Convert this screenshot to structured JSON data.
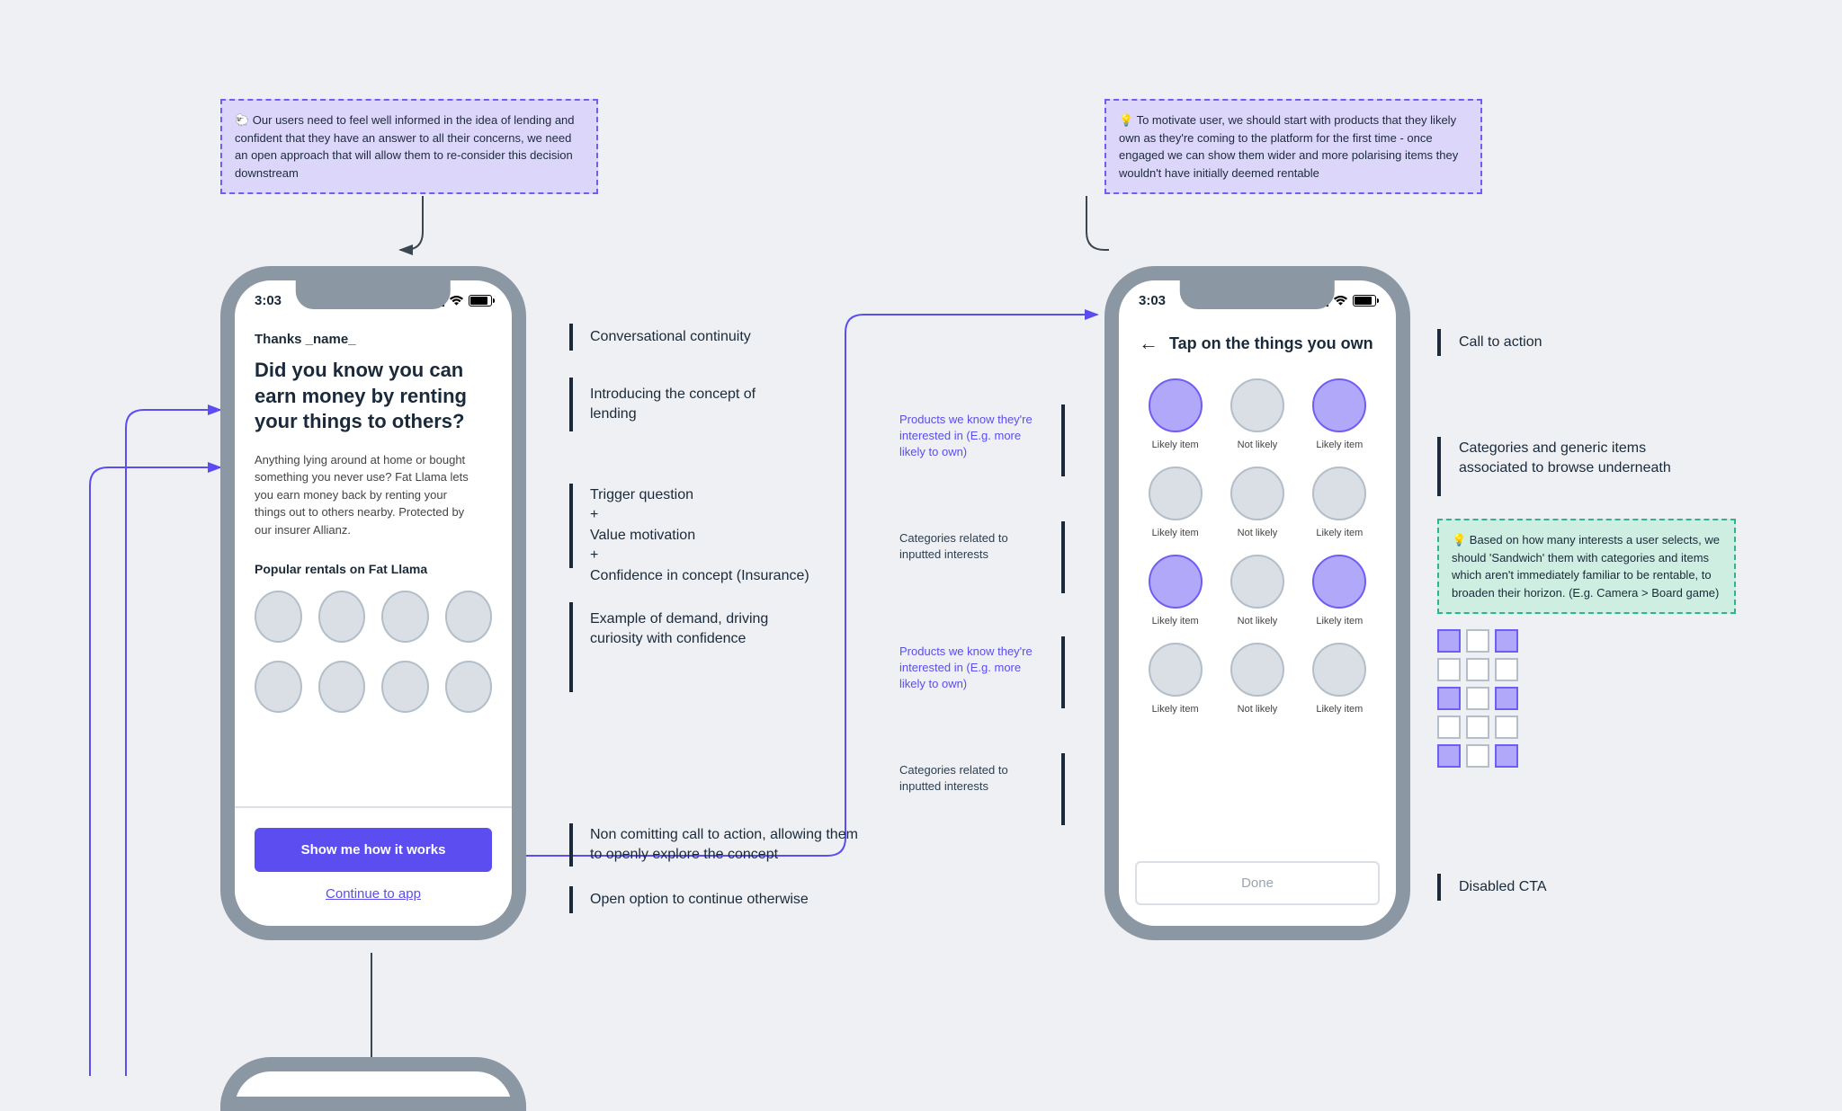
{
  "stickies": {
    "left_top": "🐑 Our users need to feel well informed in the idea of lending and confident that they have an answer to all their concerns, we need an open approach that will allow them to re-consider this decision downstream",
    "right_top": "💡 To motivate user, we should start with products that they likely own as they're coming to the platform for the first time - once engaged we can show them wider and more polarising items they wouldn't have initially deemed rentable",
    "teal": "💡 Based on how many interests a user selects, we should 'Sandwich' them with categories and items which aren't immediately familiar to be rentable, to broaden their horizon. (E.g. Camera > Board game)"
  },
  "phone1": {
    "time": "3:03",
    "greeting": "Thanks _name_",
    "headline": "Did you know you can earn money by renting your things to others?",
    "body": "Anything lying around at home or bought something you never use? Fat Llama lets you earn money back by renting your things out to others nearby. Protected by our insurer Allianz.",
    "popular_label": "Popular rentals on Fat Llama",
    "primary_cta": "Show me how it works",
    "secondary_link": "Continue to app"
  },
  "phone2": {
    "time": "3:03",
    "title": "Tap on the things you own",
    "done_label": "Done",
    "items": [
      {
        "label": "Likely item",
        "selected": true
      },
      {
        "label": "Not likely",
        "selected": false
      },
      {
        "label": "Likely item",
        "selected": true
      },
      {
        "label": "Likely item",
        "selected": false
      },
      {
        "label": "Not likely",
        "selected": false
      },
      {
        "label": "Likely item",
        "selected": false
      },
      {
        "label": "Likely item",
        "selected": true
      },
      {
        "label": "Not likely",
        "selected": false
      },
      {
        "label": "Likely item",
        "selected": true
      },
      {
        "label": "Likely item",
        "selected": false
      },
      {
        "label": "Not likely",
        "selected": false
      },
      {
        "label": "Likely item",
        "selected": false
      }
    ]
  },
  "annotations": {
    "a1": "Conversational continuity",
    "a2": "Introducing the concept of lending",
    "a3_line1": "Trigger question",
    "a3_line2": "Value motivation",
    "a3_line3": "Confidence in concept (Insurance)",
    "plus": "+",
    "a4": "Example of demand, driving curiosity with confidence",
    "a5": "Non comitting call to action, allowing them to openly explore the concept",
    "a6": "Open option to continue otherwise",
    "b1": "Products we know they're interested in (E.g. more likely to own)",
    "b2": "Categories related to inputted interests",
    "c1": "Call to action",
    "c2": "Categories and generic items associated to browse underneath",
    "c3": "Disabled CTA"
  },
  "swatches": [
    "p",
    "w",
    "p",
    "w",
    "w",
    "w",
    "p",
    "w",
    "p",
    "w",
    "w",
    "w",
    "p",
    "w",
    "p"
  ]
}
